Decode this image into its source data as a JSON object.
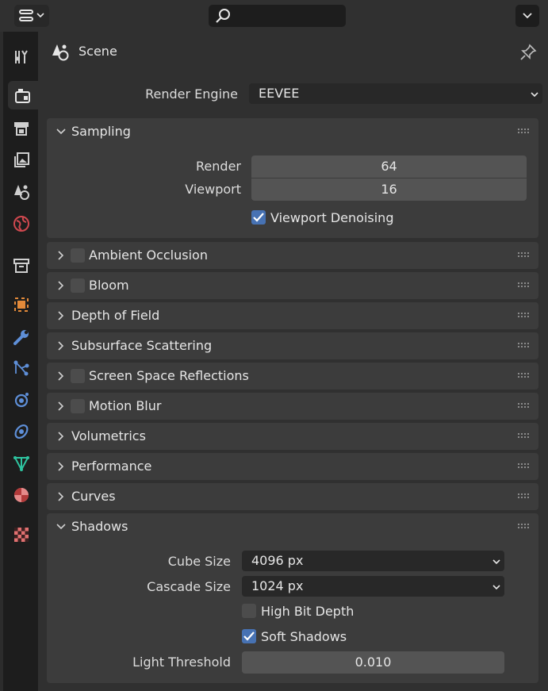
{
  "header": {
    "editor_type_icon": "properties-editor-icon",
    "search_icon": "search-icon",
    "options_icon": "chevron-down-icon"
  },
  "tabs": [
    {
      "name": "tool",
      "icon": "tool-icon"
    },
    {
      "name": "render",
      "icon": "render-icon",
      "active": true
    },
    {
      "name": "output",
      "icon": "output-icon"
    },
    {
      "name": "view-layer",
      "icon": "view-layer-icon"
    },
    {
      "name": "scene",
      "icon": "scene-icon"
    },
    {
      "name": "world",
      "icon": "world-icon"
    },
    {
      "name": "collection",
      "icon": "collection-icon"
    },
    {
      "name": "object",
      "icon": "object-icon"
    },
    {
      "name": "modifiers",
      "icon": "wrench-icon"
    },
    {
      "name": "particles",
      "icon": "particles-icon"
    },
    {
      "name": "physics",
      "icon": "physics-icon"
    },
    {
      "name": "constraints",
      "icon": "constraints-icon"
    },
    {
      "name": "data",
      "icon": "mesh-data-icon"
    },
    {
      "name": "material",
      "icon": "material-icon"
    },
    {
      "name": "texture",
      "icon": "texture-icon"
    }
  ],
  "context": {
    "label": "Scene"
  },
  "render_engine": {
    "label": "Render Engine",
    "value": "EEVEE"
  },
  "sampling": {
    "title": "Sampling",
    "render_label": "Render",
    "render_value": "64",
    "viewport_label": "Viewport",
    "viewport_value": "16",
    "denoise_label": "Viewport Denoising",
    "denoise_checked": true
  },
  "panels": [
    {
      "title": "Ambient Occlusion",
      "checkbox": true
    },
    {
      "title": "Bloom",
      "checkbox": true
    },
    {
      "title": "Depth of Field",
      "checkbox": false
    },
    {
      "title": "Subsurface Scattering",
      "checkbox": false
    },
    {
      "title": "Screen Space Reflections",
      "checkbox": true
    },
    {
      "title": "Motion Blur",
      "checkbox": true
    },
    {
      "title": "Volumetrics",
      "checkbox": false
    },
    {
      "title": "Performance",
      "checkbox": false
    },
    {
      "title": "Curves",
      "checkbox": false
    }
  ],
  "shadows": {
    "title": "Shadows",
    "cube_size_label": "Cube Size",
    "cube_size_value": "4096 px",
    "cascade_size_label": "Cascade Size",
    "cascade_size_value": "1024 px",
    "high_bit_depth_label": "High Bit Depth",
    "high_bit_depth_checked": false,
    "soft_shadows_label": "Soft Shadows",
    "soft_shadows_checked": true,
    "light_threshold_label": "Light Threshold",
    "light_threshold_value": "0.010"
  },
  "colors": {
    "accent": "#4772b3",
    "panel": "#3c3c3c",
    "field": "#545454"
  }
}
